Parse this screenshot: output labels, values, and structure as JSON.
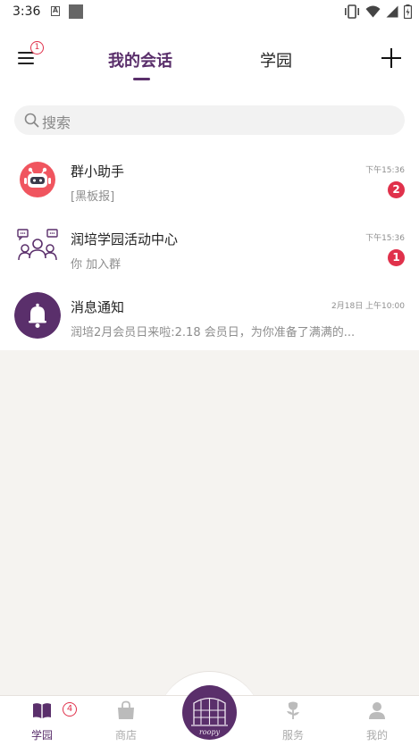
{
  "status_bar": {
    "time": "3:36",
    "a_glyph": "A"
  },
  "header": {
    "menu_badge": "1",
    "tabs": [
      {
        "label": "我的会话",
        "active": true
      },
      {
        "label": "学园",
        "active": false
      }
    ]
  },
  "search": {
    "placeholder": "搜索"
  },
  "conversations": [
    {
      "title": "群小助手",
      "subtitle": "[黑板报]",
      "time": "下午15:36",
      "badge": "2",
      "icon": "robot-icon"
    },
    {
      "title": "润培学园活动中心",
      "subtitle": "你 加入群",
      "time": "下午15:36",
      "badge": "1",
      "icon": "group-chat-icon"
    },
    {
      "title": "消息通知",
      "subtitle": "润培2月会员日来啦:2.18 会员日，为你准备了满满的...",
      "time": "2月18日 上午10:00",
      "icon": "bell-icon"
    }
  ],
  "bottom_nav": {
    "badge": "4",
    "items": [
      {
        "label": "学园",
        "active": true,
        "icon": "book-icon"
      },
      {
        "label": "商店",
        "active": false,
        "icon": "shopping-bag-icon"
      },
      {
        "label": "服务",
        "active": false,
        "icon": "flower-icon"
      },
      {
        "label": "我的",
        "active": false,
        "icon": "person-icon"
      }
    ],
    "center_logo_text": "roopy"
  },
  "colors": {
    "brand": "#5a2f6b",
    "badge": "#e0314b",
    "robot": "#f0555f"
  }
}
